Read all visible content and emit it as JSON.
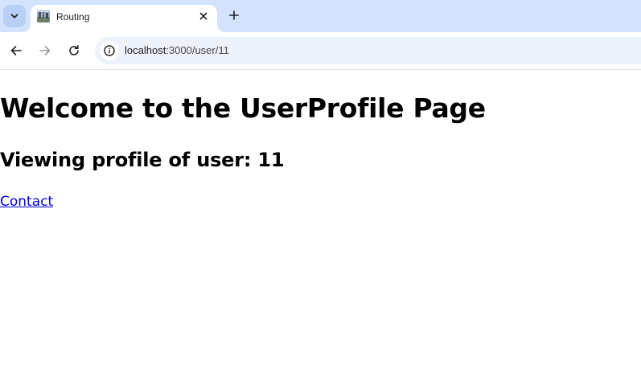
{
  "browser": {
    "tab": {
      "title": "Routing"
    },
    "address_bar": {
      "host": "localhost",
      "path": ":3000/user/11"
    },
    "icons": {
      "tab_search": "chevron-down-icon",
      "tab_close": "close-icon",
      "new_tab": "plus-icon",
      "back": "arrow-left-icon",
      "forward": "arrow-right-icon",
      "reload": "reload-icon",
      "site_info": "info-icon"
    },
    "colors": {
      "tabstrip_bg": "#d3e3fd",
      "omnibox_bg": "#edf2fa",
      "link": "#0000ee"
    }
  },
  "page": {
    "heading": "Welcome to the UserProfile Page",
    "subheading": "Viewing profile of user: 11",
    "link_label": "Contact"
  }
}
